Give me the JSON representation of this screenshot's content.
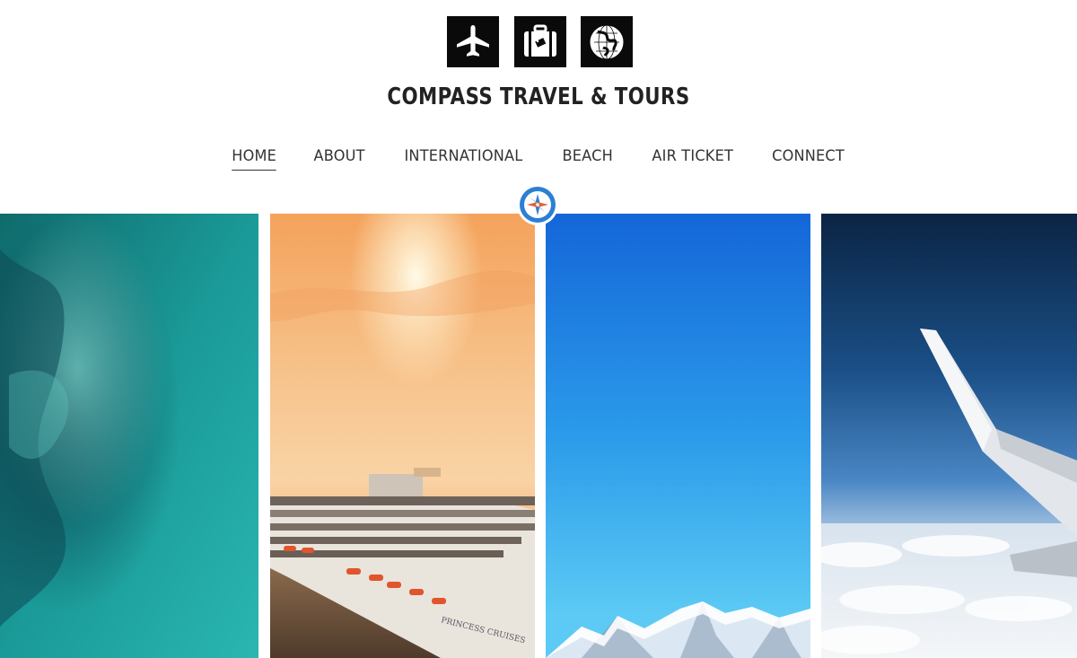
{
  "header": {
    "icons": [
      "airplane-icon",
      "luggage-icon",
      "globe-icon"
    ],
    "site_title": "COMPASS TRAVEL & TOURS"
  },
  "nav": {
    "items": [
      {
        "label": "HOME",
        "active": true
      },
      {
        "label": "ABOUT",
        "active": false
      },
      {
        "label": "INTERNATIONAL",
        "active": false
      },
      {
        "label": "BEACH",
        "active": false
      },
      {
        "label": "AIR TICKET",
        "active": false
      },
      {
        "label": "CONNECT",
        "active": false
      }
    ]
  },
  "gallery": {
    "panels": [
      {
        "name": "ocean-aerial"
      },
      {
        "name": "cruise-sunset",
        "ship_text": "PRINCESS CRUISES"
      },
      {
        "name": "blue-sky-mountains"
      },
      {
        "name": "airplane-wing-clouds"
      }
    ]
  },
  "colors": {
    "icon_bg": "#0a0a0a",
    "title": "#222222",
    "nav_text": "#333333",
    "compass_blue": "#2b7fd4"
  }
}
